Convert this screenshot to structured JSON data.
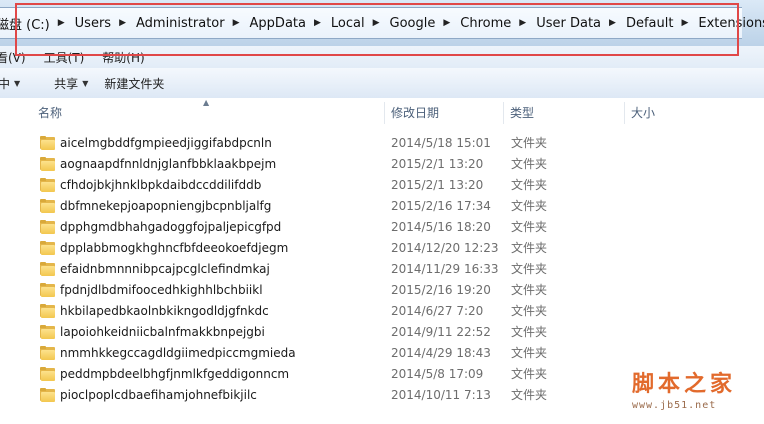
{
  "address_bar": {
    "crumbs": [
      "磁盘 (C:)",
      "Users",
      "Administrator",
      "AppData",
      "Local",
      "Google",
      "Chrome",
      "User Data",
      "Default",
      "Extensions"
    ]
  },
  "menubar": {
    "items": [
      "看(V)",
      "工具(T)",
      "帮助(H)"
    ]
  },
  "commandbar": {
    "items": [
      "中",
      "共享",
      "新建文件夹"
    ]
  },
  "columns": {
    "name": "名称",
    "date": "修改日期",
    "type": "类型",
    "size": "大小"
  },
  "files": [
    {
      "name": "aicelmgbddfgmpieedjiggifabdpcnln",
      "date": "2014/5/18 15:01",
      "type": "文件夹"
    },
    {
      "name": "aognaapdfnnldnjglanfbbklaakbpejm",
      "date": "2015/2/1 13:20",
      "type": "文件夹"
    },
    {
      "name": "cfhdojbkjhnklbpkdaibdccddilifddb",
      "date": "2015/2/1 13:20",
      "type": "文件夹"
    },
    {
      "name": "dbfmnekepjoapopniengjbcpnbljalfg",
      "date": "2015/2/16 17:34",
      "type": "文件夹"
    },
    {
      "name": "dpphgmdbhahgadoggfojpaljepicgfpd",
      "date": "2014/5/16 18:20",
      "type": "文件夹"
    },
    {
      "name": "dpplabbmogkhghncfbfdeeokoefdjegm",
      "date": "2014/12/20 12:23",
      "type": "文件夹"
    },
    {
      "name": "efaidnbmnnnibpcajpcglclefindmkaj",
      "date": "2014/11/29 16:33",
      "type": "文件夹"
    },
    {
      "name": "fpdnjdlbdmifoocedhkighhlbchbiikl",
      "date": "2015/2/16 19:20",
      "type": "文件夹"
    },
    {
      "name": "hkbilapedbkaolnbkikngodldjgfnkdc",
      "date": "2014/6/27 7:20",
      "type": "文件夹"
    },
    {
      "name": "lapoiohkeidniicbalnfmakkbnpejgbi",
      "date": "2014/9/11 22:52",
      "type": "文件夹"
    },
    {
      "name": "nmmhkkegccagdldgiimedpiccmgmieda",
      "date": "2014/4/29 18:43",
      "type": "文件夹"
    },
    {
      "name": "peddmpbdeelbhgfjnmlkfgeddigonncm",
      "date": "2014/5/8 17:09",
      "type": "文件夹"
    },
    {
      "name": "pioclpoplcdbaefihamjohnefbikjilc",
      "date": "2014/10/11 7:13",
      "type": "文件夹"
    }
  ],
  "watermark": {
    "cn": "脚本之家",
    "url": "www.jb51.net"
  },
  "colors": {
    "highlight": "#e04848",
    "folder": "#f3c74f",
    "header_text": "#4c607a",
    "watermark": "#e26a2c"
  }
}
